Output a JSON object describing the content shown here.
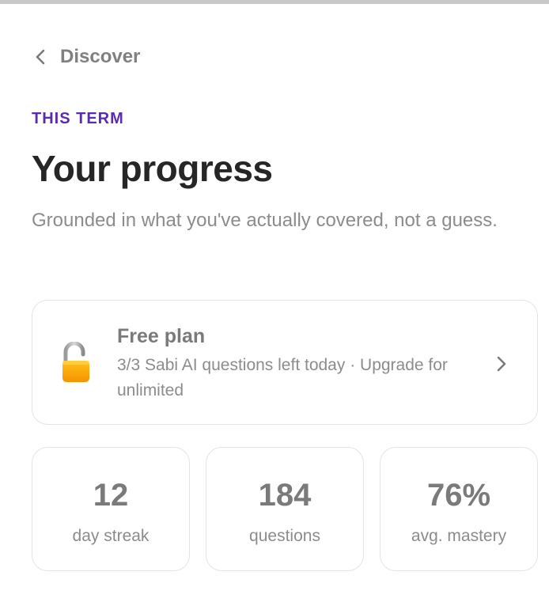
{
  "nav": {
    "back_label": "Discover",
    "back_icon": "chevron-left-icon"
  },
  "header": {
    "eyebrow": "THIS TERM",
    "title": "Your progress",
    "subtitle": "Grounded in what you've actually covered, not a guess.",
    "eyebrow_color": "#5b2bb3"
  },
  "plan_card": {
    "icon": "unlocked-padlock-icon",
    "name": "Free plan",
    "detail": "3/3 Sabi AI questions left today · Upgrade for unlimited",
    "chevron_icon": "chevron-right-icon",
    "lock_color": "#f5a300"
  },
  "stats": [
    {
      "value": "12",
      "label": "day streak"
    },
    {
      "value": "184",
      "label": "questions"
    },
    {
      "value": "76%",
      "label": "avg. mastery"
    }
  ]
}
